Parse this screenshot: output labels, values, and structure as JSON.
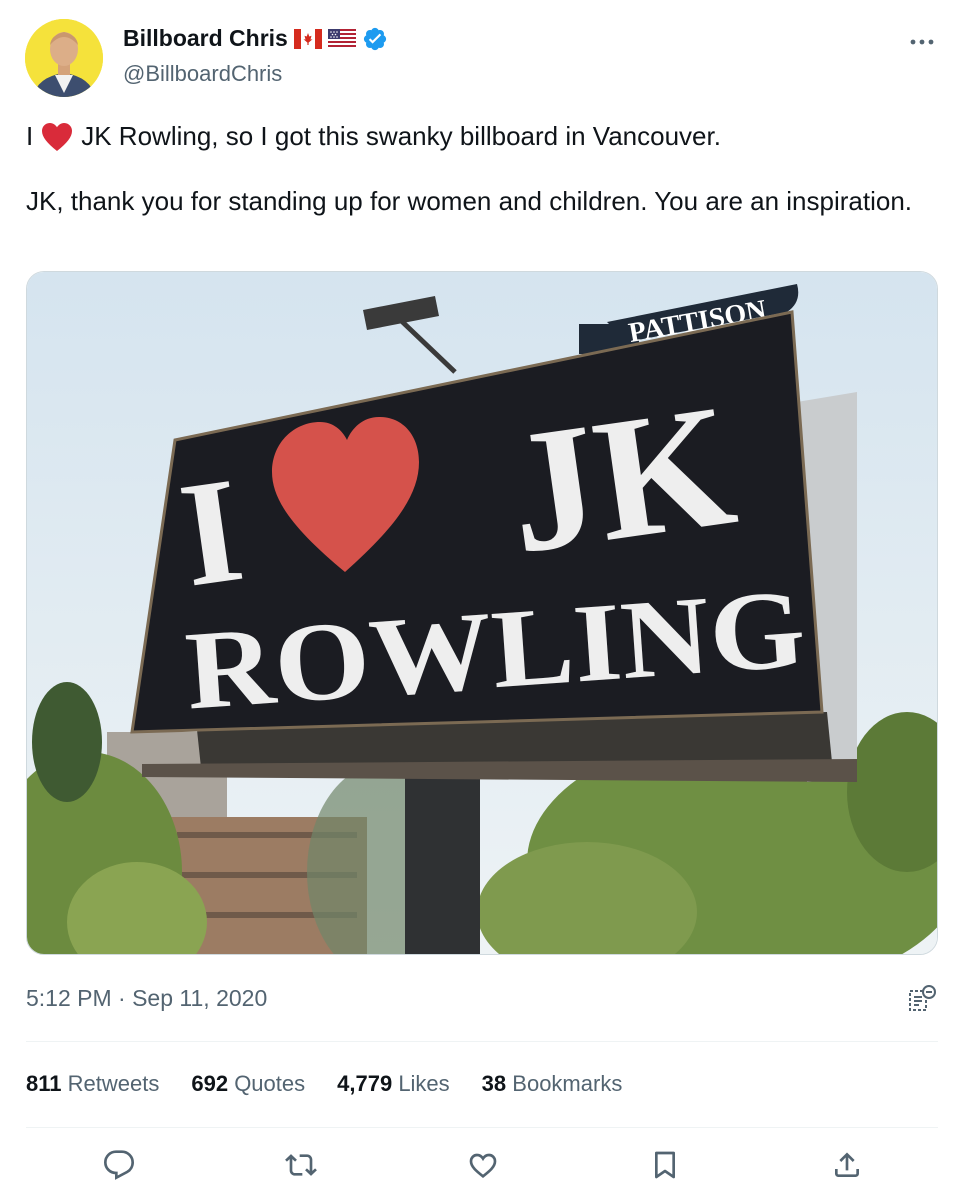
{
  "author": {
    "display_name": "Billboard Chris",
    "handle": "@BillboardChris",
    "flags": [
      "canada-flag-icon",
      "usa-flag-icon"
    ],
    "verified": true
  },
  "tweet": {
    "text_line1_prefix": "I",
    "text_line1_suffix": "JK Rowling, so I got this swanky billboard in Vancouver.",
    "text_paragraph2": "JK, thank you for standing up for women and children. You are an inspiration.",
    "timestamp": "5:12 PM · Sep 11, 2020"
  },
  "media": {
    "billboard_line1_left": "I",
    "billboard_line1_right": "JK",
    "billboard_line2": "ROWLING",
    "billboard_brand": "PATTISON"
  },
  "stats": {
    "retweets_count": "811",
    "retweets_label": "Retweets",
    "quotes_count": "692",
    "quotes_label": "Quotes",
    "likes_count": "4,779",
    "likes_label": "Likes",
    "bookmarks_count": "38",
    "bookmarks_label": "Bookmarks"
  },
  "actions": [
    "reply-icon",
    "retweet-icon",
    "like-icon",
    "bookmark-icon",
    "share-icon"
  ],
  "colors": {
    "text_primary": "#0f1419",
    "text_secondary": "#536471",
    "verified_blue": "#1d9bf0",
    "heart_red": "#d92b3a",
    "divider": "#eff3f4"
  }
}
